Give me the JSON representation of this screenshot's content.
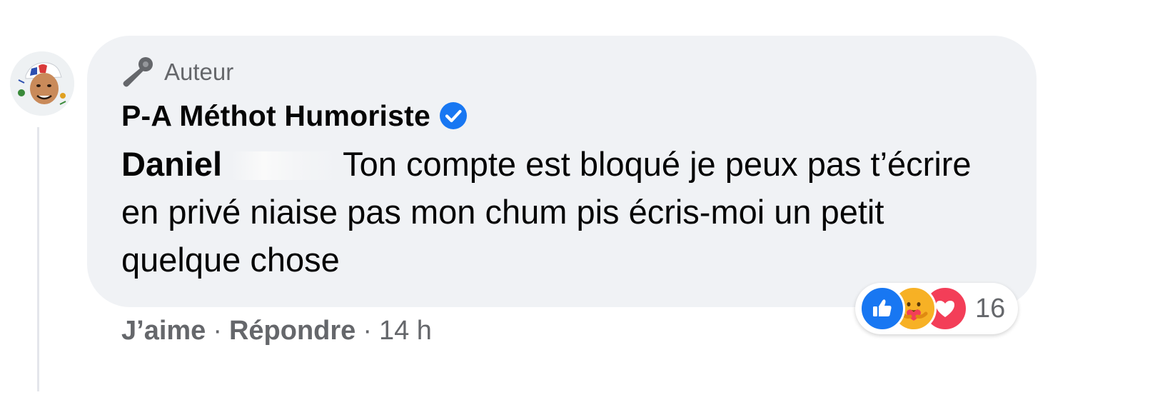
{
  "comment": {
    "badge_label": "Auteur",
    "author_name": "P-A Méthot Humoriste",
    "mention": "Daniel",
    "text": "Ton compte est bloqué je peux pas t’écrire en privé niaise pas mon chum pis écris-moi un petit quelque chose"
  },
  "reactions": {
    "icons": [
      "like-icon",
      "care-icon",
      "love-icon"
    ],
    "count": "16",
    "colors": {
      "like": "#1877f2",
      "love": "#f33e58",
      "care": "#f7b125"
    }
  },
  "actions": {
    "like_label": "J’aime",
    "separator": "·",
    "reply_label": "Répondre",
    "timestamp": "14 h"
  },
  "colors": {
    "bubble": "#f0f2f5",
    "verified": "#1877f2",
    "secondary_text": "#65676b"
  }
}
